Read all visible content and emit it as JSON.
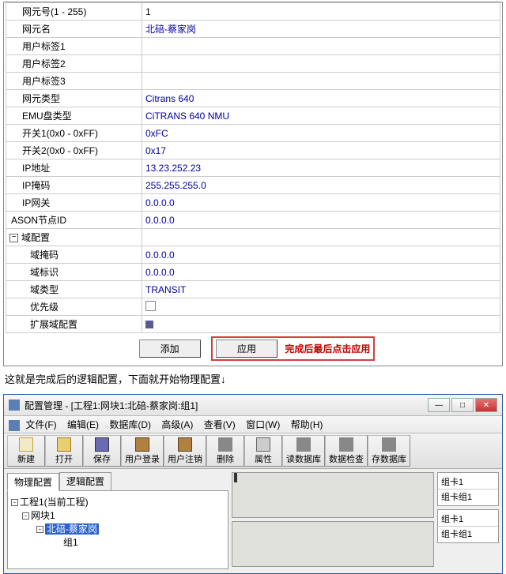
{
  "prop": {
    "rows": [
      {
        "label": "网元号(1 - 255)",
        "value": "1"
      },
      {
        "label": "网元名",
        "value": "北碚-蔡家岗"
      },
      {
        "label": "用户标签1",
        "value": ""
      },
      {
        "label": "用户标签2",
        "value": ""
      },
      {
        "label": "用户标签3",
        "value": ""
      },
      {
        "label": "网元类型",
        "value": "Citrans 640"
      },
      {
        "label": "EMU盘类型",
        "value": "CiTRANS 640 NMU"
      },
      {
        "label": "开关1(0x0 - 0xFF)",
        "value": "0xFC"
      },
      {
        "label": "开关2(0x0 - 0xFF)",
        "value": "0x17"
      },
      {
        "label": "IP地址",
        "value": "13.23.252.23"
      },
      {
        "label": "IP掩码",
        "value": "255.255.255.0"
      },
      {
        "label": "IP网关",
        "value": "0.0.0.0"
      },
      {
        "label": "ASON节点ID",
        "value": "0.0.0.0"
      }
    ],
    "domain_section": "域配置",
    "domain_rows": [
      {
        "label": "域掩码",
        "value": "0.0.0.0"
      },
      {
        "label": "域标识",
        "value": "0.0.0.0"
      },
      {
        "label": "域类型",
        "value": "TRANSIT"
      }
    ],
    "priority_label": "优先级",
    "ext_label": "扩展域配置",
    "add_btn": "添加",
    "apply_btn": "应用",
    "red_note": "完成后最后点击应用"
  },
  "mid_text": "这就是完成后的逻辑配置，下面就开始物理配置↓",
  "win2": {
    "title": "配置管理 - [工程1:网块1:北碚-蔡家岗:组1]",
    "menu": [
      "文件(F)",
      "编辑(E)",
      "数据库(D)",
      "高级(A)",
      "查看(V)",
      "窗口(W)",
      "帮助(H)"
    ],
    "toolbar": [
      {
        "name": "new",
        "label": "新建",
        "ico": "new"
      },
      {
        "name": "open",
        "label": "打开",
        "ico": "open"
      },
      {
        "name": "save",
        "label": "保存",
        "ico": "save"
      },
      {
        "name": "login",
        "label": "用户登录",
        "ico": "user",
        "wide": true
      },
      {
        "name": "logout",
        "label": "用户注销",
        "ico": "user",
        "wide": true
      },
      {
        "name": "delete",
        "label": "删除",
        "ico": "del"
      },
      {
        "name": "props",
        "label": "属性",
        "ico": "prop"
      },
      {
        "name": "readdb",
        "label": "读数据库",
        "ico": "db",
        "wide": true
      },
      {
        "name": "checkdb",
        "label": "数据检查",
        "ico": "db",
        "wide": true
      },
      {
        "name": "savedb",
        "label": "存数据库",
        "ico": "db",
        "wide": true
      }
    ],
    "tabs": {
      "phys": "物理配置",
      "logic": "逻辑配置"
    },
    "tree": {
      "root": "工程1(当前工程)",
      "block": "网块1",
      "ne": "北碚-蔡家岗",
      "group": "组1"
    },
    "right": {
      "r1": "组卡1",
      "r2": "组卡组1"
    }
  }
}
